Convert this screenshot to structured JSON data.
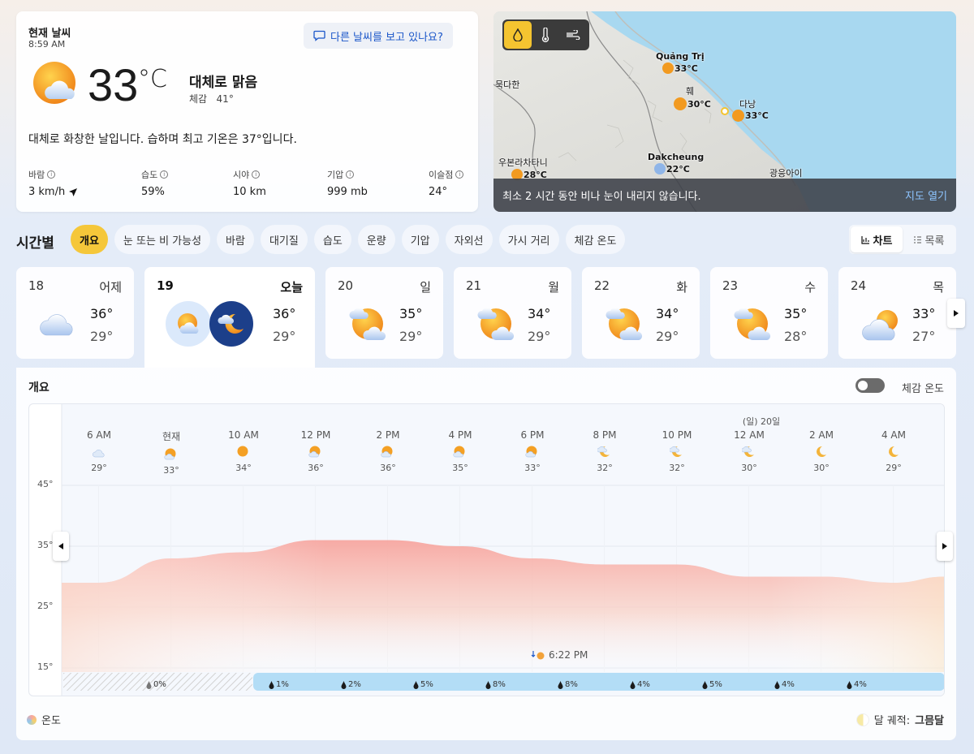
{
  "current": {
    "title": "현재 날씨",
    "time": "8:59 AM",
    "other_weather": "다른 날씨를 보고 있나요?",
    "temp": "33",
    "unit": "°C",
    "condition": "대체로 맑음",
    "feels_label": "체감",
    "feels_value": "41°",
    "summary": "대체로 화창한 날입니다. 습하며 최고 기온은 37°입니다.",
    "stats": [
      {
        "label": "바람",
        "value": "3 km/h"
      },
      {
        "label": "습도",
        "value": "59%"
      },
      {
        "label": "시야",
        "value": "10 km"
      },
      {
        "label": "기압",
        "value": "999 mb"
      },
      {
        "label": "이슬점",
        "value": "24°"
      }
    ]
  },
  "map": {
    "labels": {
      "mukdahan": "묵다한",
      "ubon": "우본라차타니",
      "kwang": "광응아이"
    },
    "cities": [
      {
        "name": "Quảng Trị",
        "temp": "33°C"
      },
      {
        "name": "훼",
        "temp": "30°C"
      },
      {
        "name": "다낭",
        "temp": "33°C"
      },
      {
        "name": "Dakcheung",
        "temp": "22°C"
      },
      {
        "name": "우본라차타니",
        "temp": "28°C"
      }
    ],
    "footer_text": "최소 2 시간 동안 비나 눈이 내리지 않습니다.",
    "open_label": "지도 열기"
  },
  "hourly": {
    "title": "시간별",
    "tabs": [
      "개요",
      "눈 또는 비 가능성",
      "바람",
      "대기질",
      "습도",
      "운량",
      "기압",
      "자외선",
      "가시 거리",
      "체감 온도"
    ],
    "view_chart": "차트",
    "view_list": "목록"
  },
  "days": [
    {
      "num": "18",
      "name": "어제",
      "hi": "36°",
      "lo": "29°",
      "icon": "cloudy-icon"
    },
    {
      "num": "19",
      "name": "오늘",
      "hi": "36°",
      "lo": "29°",
      "icon": "partly-sunny-icon"
    },
    {
      "num": "20",
      "name": "일",
      "hi": "35°",
      "lo": "29°",
      "icon": "partly-sunny-icon"
    },
    {
      "num": "21",
      "name": "월",
      "hi": "34°",
      "lo": "29°",
      "icon": "partly-sunny-icon"
    },
    {
      "num": "22",
      "name": "화",
      "hi": "34°",
      "lo": "29°",
      "icon": "partly-sunny-icon"
    },
    {
      "num": "23",
      "name": "수",
      "hi": "35°",
      "lo": "28°",
      "icon": "partly-sunny-icon"
    },
    {
      "num": "24",
      "name": "목",
      "hi": "33°",
      "lo": "27°",
      "icon": "mostly-cloudy-icon"
    }
  ],
  "overview": {
    "title": "개요",
    "feels_toggle_label": "체감 온도",
    "day_marker": "(일) 20일",
    "sunset": "6:22 PM",
    "legend_temp": "온도",
    "moon_label": "달 궤적:",
    "moon_phase": "그믐달"
  },
  "chart_data": {
    "type": "area",
    "x": [
      "6 AM",
      "현재",
      "10 AM",
      "12 PM",
      "2 PM",
      "4 PM",
      "6 PM",
      "8 PM",
      "10 PM",
      "12 AM",
      "2 AM",
      "4 AM"
    ],
    "temps": [
      29,
      33,
      34,
      36,
      36,
      35,
      33,
      32,
      32,
      30,
      30,
      29
    ],
    "temp_labels": [
      "29°",
      "33°",
      "34°",
      "36°",
      "36°",
      "35°",
      "33°",
      "32°",
      "32°",
      "30°",
      "30°",
      "29°"
    ],
    "icons": [
      "cloudy-icon",
      "partly-sunny-icon",
      "sunny-icon",
      "partly-sunny-icon",
      "partly-sunny-icon",
      "partly-sunny-icon",
      "partly-cloudy-icon",
      "partly-cloudy-night-icon",
      "partly-cloudy-night-icon",
      "partly-cloudy-night-icon",
      "moon-icon",
      "moon-icon"
    ],
    "precip": [
      "0%",
      "1%",
      "2%",
      "5%",
      "8%",
      "8%",
      "4%",
      "5%",
      "4%",
      "4%"
    ],
    "yticks": [
      "45°",
      "35°",
      "25°",
      "15°"
    ],
    "ylim": [
      15,
      45
    ]
  }
}
